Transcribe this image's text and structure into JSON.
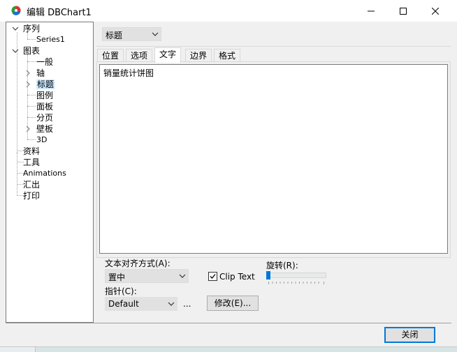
{
  "window": {
    "title": "编辑 DBChart1"
  },
  "tree": {
    "items": [
      {
        "label": "序列",
        "expander": "expanded"
      },
      {
        "label": "Series1",
        "expander": "none"
      },
      {
        "label": "图表",
        "expander": "expanded"
      },
      {
        "label": "一般",
        "expander": "none"
      },
      {
        "label": "轴",
        "expander": "collapsed"
      },
      {
        "label": "标题",
        "expander": "collapsed",
        "selected": true
      },
      {
        "label": "图例",
        "expander": "none"
      },
      {
        "label": "面板",
        "expander": "none"
      },
      {
        "label": "分页",
        "expander": "none"
      },
      {
        "label": "壁板",
        "expander": "collapsed"
      },
      {
        "label": "3D",
        "expander": "none"
      },
      {
        "label": "资料",
        "expander": "none"
      },
      {
        "label": "工具",
        "expander": "none"
      },
      {
        "label": "Animations",
        "expander": "none"
      },
      {
        "label": "汇出",
        "expander": "none"
      },
      {
        "label": "打印",
        "expander": "none"
      }
    ]
  },
  "title_selector": {
    "value": "标题"
  },
  "tabs": [
    {
      "label": "位置"
    },
    {
      "label": "选项"
    },
    {
      "label": "文字",
      "active": true
    },
    {
      "label": "边界"
    },
    {
      "label": "格式"
    }
  ],
  "text_area": {
    "value": "销量统计饼图"
  },
  "alignment": {
    "label": "文本对齐方式(A):",
    "value": "置中"
  },
  "clip_text": {
    "label": "Clip Text",
    "checked": true
  },
  "rotation": {
    "label": "旋转(R):",
    "value": 0
  },
  "pointer": {
    "label": "指针(C):",
    "value": "Default",
    "ellipsis": "..."
  },
  "modify_button": {
    "label": "修改(E)..."
  },
  "close_button": {
    "label": "关闭"
  },
  "colors": {
    "accent": "#0078d7",
    "selection": "#cce8ff"
  }
}
